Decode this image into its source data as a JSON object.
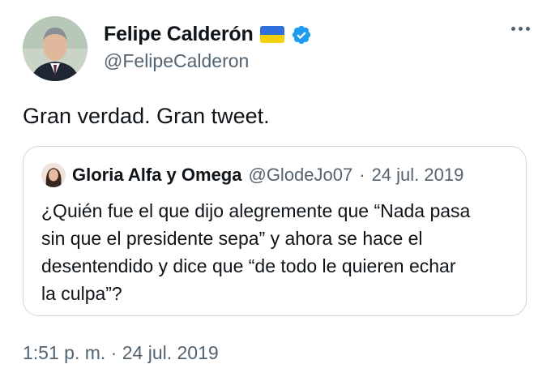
{
  "author": {
    "display_name": "Felipe Calderón",
    "handle": "@FelipeCalderon",
    "badges": [
      "ukraine-flag",
      "verified-badge"
    ]
  },
  "tweet": {
    "text": "Gran verdad. Gran tweet.",
    "time": "1:51 p. m.",
    "separator": "·",
    "date": "24 jul. 2019"
  },
  "quoted": {
    "display_name": "Gloria Alfa y Omega",
    "handle": "@GlodeJo07",
    "separator": "·",
    "date": "24 jul. 2019",
    "lines": [
      "¿Quién fue el que dijo alegremente que “Nada pasa",
      "sin que el presidente sepa” y ahora se hace el",
      "desentendido y dice que “de todo le quieren echar",
      "la culpa”?"
    ]
  },
  "colors": {
    "text": "#0f1419",
    "secondary": "#536471",
    "border": "#cfd9de",
    "verified": "#1d9bf0"
  }
}
